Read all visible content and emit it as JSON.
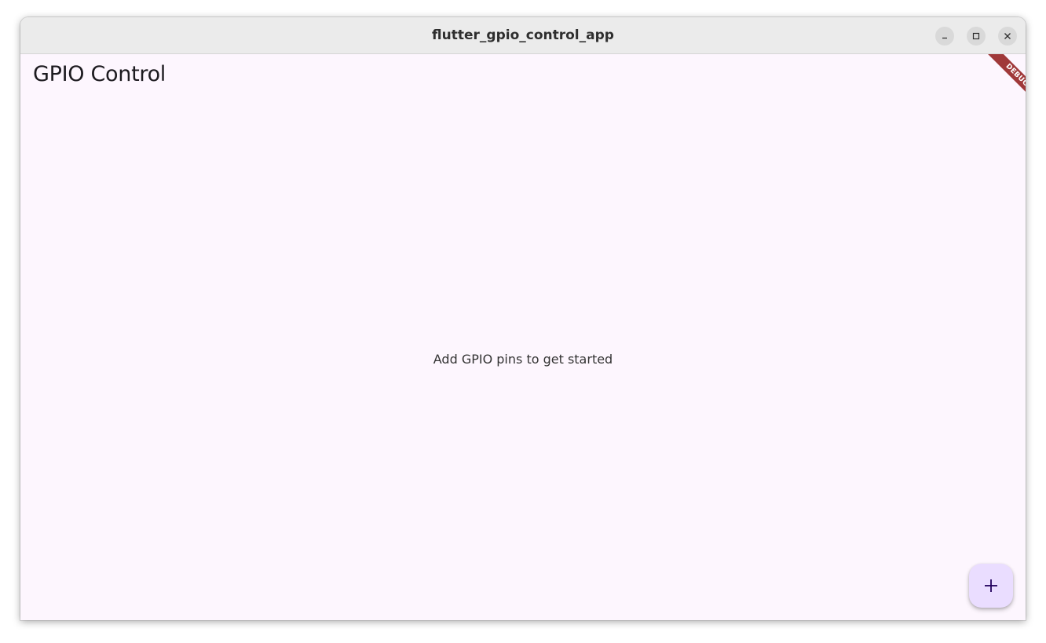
{
  "window": {
    "title": "flutter_gpio_control_app",
    "controls": {
      "minimize_icon": "minimize-icon",
      "maximize_icon": "maximize-icon",
      "close_icon": "close-icon"
    }
  },
  "app": {
    "title": "GPIO Control",
    "empty_message": "Add GPIO pins to get started",
    "debug_banner": "DEBUG",
    "fab_icon": "plus-icon"
  },
  "colors": {
    "background": "#fdf6fe",
    "fab_background": "#eaddff",
    "fab_icon": "#21005d",
    "debug_banner": "#a0393a",
    "titlebar": "#ebebeb"
  }
}
